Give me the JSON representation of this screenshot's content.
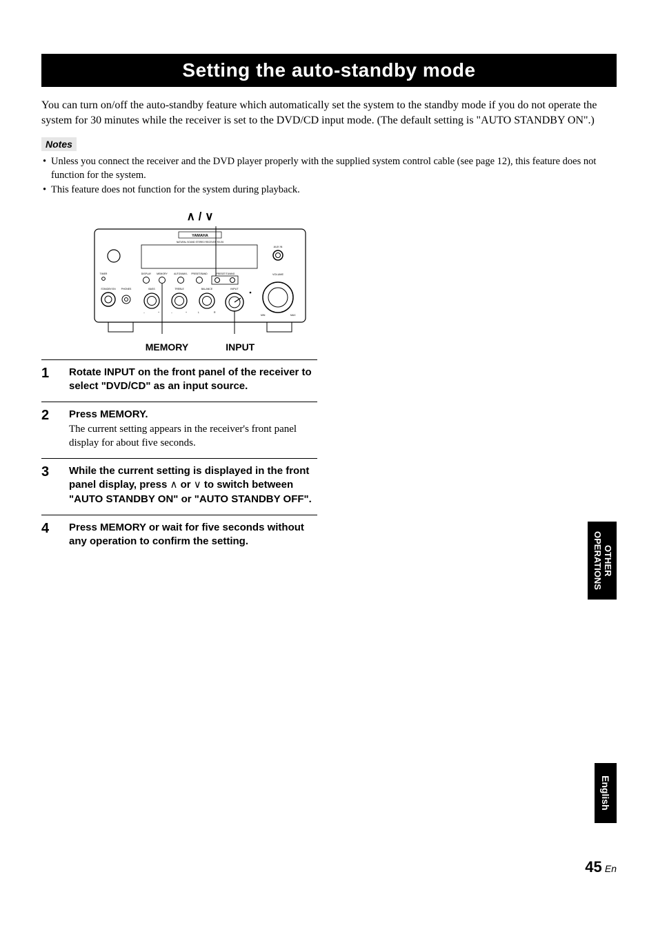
{
  "title": "Setting the auto-standby mode",
  "intro": "You can turn on/off the auto-standby feature which automatically set the system to the standby mode if you do not operate the system for 30 minutes while the receiver is set to the DVD/CD input mode. (The default setting is \"AUTO STANDBY ON\".)",
  "notes_label": "Notes",
  "notes": [
    "Unless you connect the receiver and the DVD player properly with the supplied system control cable (see page 12), this feature does not function for the system.",
    "This feature does not function for the system during playback."
  ],
  "figure": {
    "top_label": "∧ / ∨",
    "brand": "YAMAHA",
    "subbrand": "NATURAL SOUND STEREO RECEIVER  RX-E6",
    "labels": {
      "timer": "TIMER",
      "display": "DISPLAY",
      "memory": "MEMORY",
      "autoeq": "AUTO/MAN'L",
      "preset": "PRESET/BAND",
      "tuning": "PRESET/TUNING",
      "aux": "AUX IN",
      "volume": "VOLUME",
      "standby": "STANDBY/ON",
      "phones": "PHONES",
      "bass": "BASS",
      "treble": "TREBLE",
      "balance": "BALANCE",
      "input": "INPUT",
      "min": "MIN",
      "max": "MAX",
      "l": "L",
      "r": "R",
      "plus": "+",
      "minus": "–"
    },
    "bottom_left": "MEMORY",
    "bottom_right": "INPUT"
  },
  "steps": [
    {
      "num": "1",
      "bold": "Rotate INPUT on the front panel of the receiver to select \"DVD/CD\" as an input source.",
      "rest": ""
    },
    {
      "num": "2",
      "bold": "Press MEMORY.",
      "rest": "The current setting appears in the receiver's front panel display for about five seconds."
    },
    {
      "num": "3",
      "bold_pre": "While the current setting is displayed in the front panel display, press ",
      "bold_mid1": "∧",
      "bold_or": " or ",
      "bold_mid2": "∨",
      "bold_post": " to switch between \"AUTO STANDBY ON\" or \"AUTO STANDBY OFF\".",
      "rest": ""
    },
    {
      "num": "4",
      "bold": "Press MEMORY or wait for five seconds without any operation to confirm the setting.",
      "rest": ""
    }
  ],
  "sidetabs": {
    "ops_line1": "OTHER",
    "ops_line2": "OPERATIONS",
    "lang": "English"
  },
  "page": {
    "num": "45",
    "suffix": "En"
  }
}
